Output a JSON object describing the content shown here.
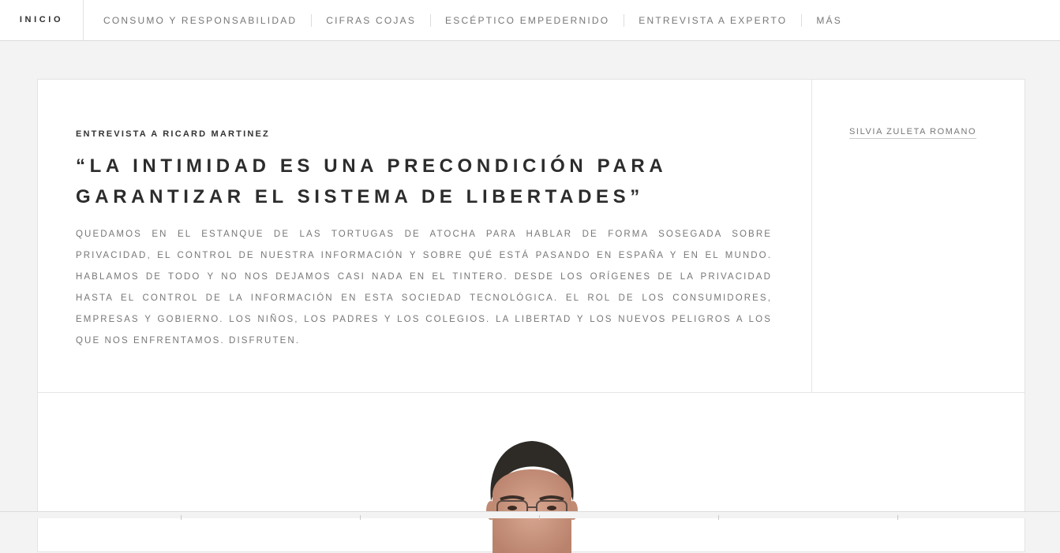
{
  "topbar": {
    "home_label": "INICIO",
    "nav": [
      {
        "label": "CONSUMO Y RESPONSABILIDAD"
      },
      {
        "label": "CIFRAS COJAS"
      },
      {
        "label": "ESCÉPTICO EMPEDERNIDO"
      },
      {
        "label": "ENTREVISTA A EXPERTO"
      },
      {
        "label": "MÁS"
      }
    ]
  },
  "article": {
    "kicker": "ENTREVISTA A RICARD MARTINEZ",
    "title": "“LA INTIMIDAD ES UNA PRECONDICIÓN PARA GARANTIZAR EL SISTEMA DE LIBERTADES”",
    "excerpt": "QUEDAMOS EN EL ESTANQUE DE LAS TORTUGAS DE ATOCHA PARA HABLAR DE FORMA SOSEGADA SOBRE PRIVACIDAD, EL CONTROL DE NUESTRA INFORMACIÓN Y SOBRE QUÉ ESTÁ PASANDO EN ESPAÑA Y EN EL MUNDO. HABLAMOS DE TODO Y NO NOS DEJAMOS CASI NADA EN EL TINTERO. DESDE LOS ORÍGENES DE LA PRIVACIDAD HASTA EL CONTROL DE LA INFORMACIÓN EN ESTA SOCIEDAD TECNOLÓGICA. EL ROL DE LOS CONSUMIDORES, EMPRESAS Y GOBIERNO. LOS NIÑOS, LOS PADRES Y LOS COLEGIOS. LA LIBERTAD Y LOS NUEVOS PELIGROS A LOS QUE NOS ENFRENTAMOS. DISFRUTEN.",
    "author": "SILVIA ZULETA ROMANO"
  },
  "colors": {
    "page_background": "#f3f3f3",
    "card_background": "#ffffff",
    "heading_text": "#2c2c2c",
    "body_text": "#777777"
  },
  "icons": {
    "portrait": "person-photo"
  }
}
